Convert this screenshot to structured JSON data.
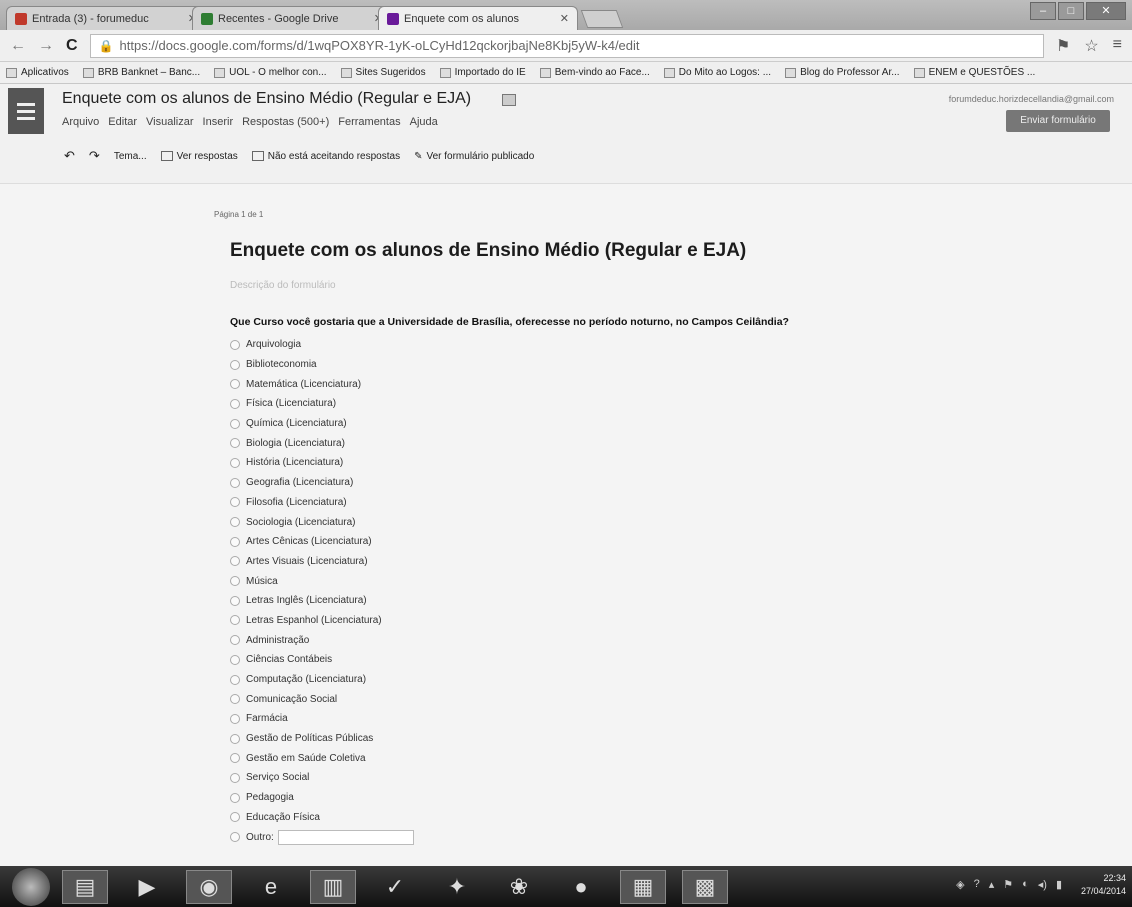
{
  "browser": {
    "tabs": [
      {
        "label": "Entrada (3) - forumeduc",
        "color": "#c0392b"
      },
      {
        "label": "Recentes - Google Drive",
        "color": "#2e7d32"
      },
      {
        "label": "Enquete com os alunos",
        "color": "#6a1b9a",
        "active": true
      }
    ],
    "address": "https://docs.google.com/forms/d/1wqPOX8YR-1yK-oLCyHd12qckorjbajNe8Kbj5yW-k4/edit",
    "bookmarks": [
      "Aplicativos",
      "BRB Banknet – Banc...",
      "UOL - O melhor con...",
      "Sites Sugeridos",
      "Importado do IE",
      "Bem-vindo ao Face...",
      "Do Mito ao Logos: ...",
      "Blog do Professor Ar...",
      "ENEM e QUESTÕES ..."
    ]
  },
  "app": {
    "doc_title": "Enquete com os alunos de Ensino Médio (Regular e EJA)",
    "menus": [
      "Arquivo",
      "Editar",
      "Visualizar",
      "Inserir",
      "Respostas (500+)",
      "Ferramentas",
      "Ajuda"
    ],
    "account": "forumdeduc.horizdecellandia@gmail.com",
    "send_label": "Enviar formulário",
    "toolbar": {
      "theme": "Tema...",
      "view_responses": "Ver respostas",
      "not_accepting": "Não está aceitando respostas",
      "view_published": "Ver formulário publicado"
    }
  },
  "form": {
    "page_indicator": "Página 1 de 1",
    "title": "Enquete com os alunos de Ensino Médio (Regular e EJA)",
    "description_placeholder": "Descrição do formulário",
    "question": "Que Curso você gostaria que a Universidade de Brasília, oferecesse no período noturno, no Campos Ceilândia?",
    "options": [
      "Arquivologia",
      "Biblioteconomia",
      "Matemática (Licenciatura)",
      "Física (Licenciatura)",
      "Química (Licenciatura)",
      "Biologia (Licenciatura)",
      "História (Licenciatura)",
      "Geografia (Licenciatura)",
      "Filosofia (Licenciatura)",
      "Sociologia (Licenciatura)",
      "Artes Cênicas (Licenciatura)",
      "Artes Visuais (Licenciatura)",
      "Música",
      "Letras Inglês (Licenciatura)",
      "Letras Espanhol (Licenciatura)",
      "Administração",
      "Ciências Contábeis",
      "Computação (Licenciatura)",
      "Comunicação Social",
      "Farmácia",
      "Gestão de Políticas Públicas",
      "Gestão em Saúde Coletiva",
      "Serviço Social",
      "Pedagogia",
      "Educação Física"
    ],
    "other_label": "Outro:"
  },
  "taskbar": {
    "time": "22:34",
    "date": "27/04/2014"
  }
}
